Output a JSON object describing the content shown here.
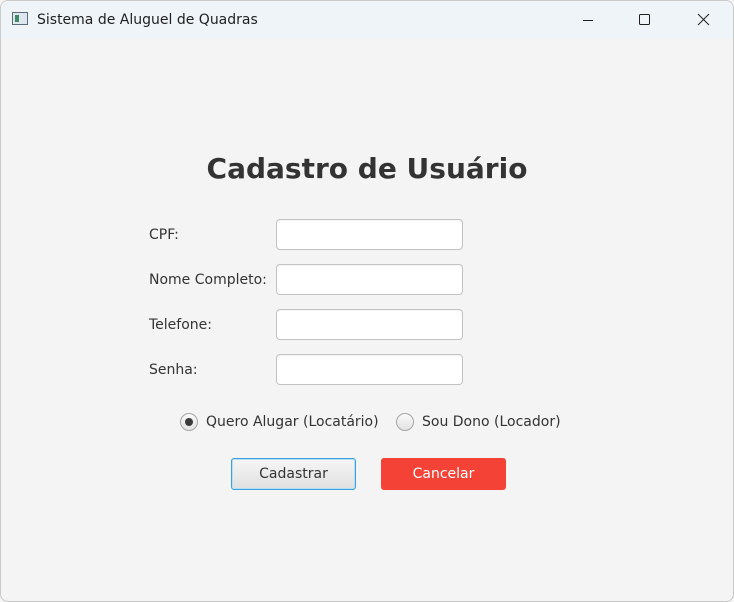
{
  "window": {
    "title": "Sistema de Aluguel de Quadras",
    "icon": "java-app-icon",
    "controls": [
      "minimize-icon",
      "maximize-icon",
      "close-icon"
    ]
  },
  "form": {
    "heading": "Cadastro de Usuário",
    "fields": [
      {
        "label": "CPF:",
        "value": "",
        "placeholder": ""
      },
      {
        "label": "Nome Completo:",
        "value": "",
        "placeholder": ""
      },
      {
        "label": "Telefone:",
        "value": "",
        "placeholder": ""
      },
      {
        "label": "Senha:",
        "value": "",
        "placeholder": ""
      }
    ],
    "roles": [
      {
        "label": "Quero Alugar (Locatário)",
        "selected": true
      },
      {
        "label": "Sou Dono (Locador)",
        "selected": false
      }
    ],
    "buttons": {
      "submit_label": "Cadastrar",
      "cancel_label": "Cancelar"
    }
  },
  "colors": {
    "cancel_background": "#f44336",
    "focus_border": "#39a0dd",
    "titlebar": "#eff4f9",
    "background": "#f4f4f4"
  }
}
